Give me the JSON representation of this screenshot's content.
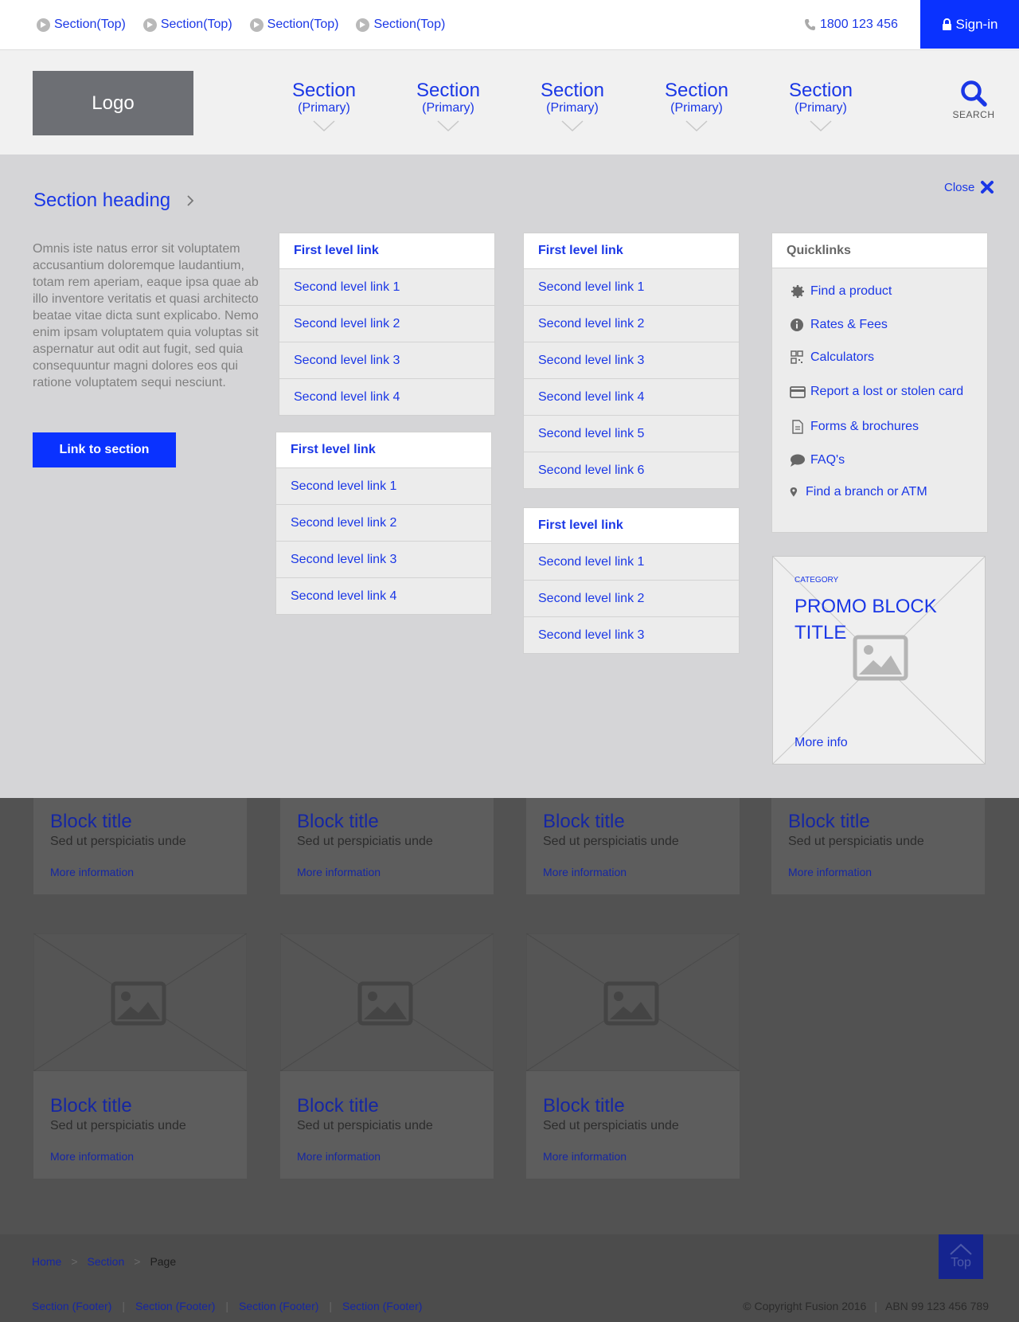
{
  "topbar": {
    "links": [
      "Section(Top)",
      "Section(Top)",
      "Section(Top)",
      "Section(Top)"
    ],
    "phone": "1800 123 456",
    "signin": "Sign-in"
  },
  "header": {
    "logo": "Logo",
    "primary_nav": [
      {
        "title": "Section",
        "sub": "(Primary)"
      },
      {
        "title": "Section",
        "sub": "(Primary)"
      },
      {
        "title": "Section",
        "sub": "(Primary)"
      },
      {
        "title": "Section",
        "sub": "(Primary)"
      },
      {
        "title": "Section",
        "sub": "(Primary)"
      }
    ],
    "search_label": "SEARCH"
  },
  "mega": {
    "heading": "Section heading",
    "close": "Close",
    "intro": "Omnis iste natus error sit voluptatem accusantium doloremque laudantium, totam rem aperiam, eaque ipsa quae ab illo inventore veritatis et quasi architecto beatae vitae dicta sunt explicabo. Nemo enim ipsam voluptatem quia voluptas sit aspernatur aut odit aut fugit, sed quia consequuntur magni dolores eos qui ratione voluptatem sequi nesciunt.",
    "button": "Link to section",
    "menus": [
      {
        "first": "First level link",
        "seconds": [
          "Second level link 1",
          "Second level link 2",
          "Second level link 3",
          "Second level link 4"
        ]
      },
      {
        "first": "First level link",
        "seconds": [
          "Second level link 1",
          "Second level link 2",
          "Second level link 3",
          "Second level link 4"
        ]
      },
      {
        "first": "First level link",
        "seconds": [
          "Second level link 1",
          "Second level link 2",
          "Second level link 3",
          "Second level link 4",
          "Second level link 5",
          "Second level link 6"
        ]
      },
      {
        "first": "First level link",
        "seconds": [
          "Second level link 1",
          "Second level link 2",
          "Second level link 3"
        ]
      }
    ],
    "quicklinks": {
      "title": "Quicklinks",
      "items": [
        {
          "icon": "gear-icon",
          "label": "Find a product"
        },
        {
          "icon": "info-icon",
          "label": "Rates & Fees"
        },
        {
          "icon": "calculator-icon",
          "label": "Calculators"
        },
        {
          "icon": "credit-card-icon",
          "label": "Report a lost or stolen card"
        },
        {
          "icon": "document-icon",
          "label": "Forms & brochures"
        },
        {
          "icon": "chat-bubble-icon",
          "label": "FAQ's"
        },
        {
          "icon": "map-pin-icon",
          "label": "Find a branch or ATM"
        }
      ]
    },
    "promo": {
      "category": "CATEGORY",
      "title": "PROMO BLOCK TITLE",
      "more": "More info"
    }
  },
  "cards": [
    {
      "title": "Block title",
      "sub": "Sed ut perspiciatis unde",
      "more": "More information"
    },
    {
      "title": "Block title",
      "sub": "Sed ut perspiciatis unde",
      "more": "More information"
    },
    {
      "title": "Block title",
      "sub": "Sed ut perspiciatis unde",
      "more": "More information"
    },
    {
      "title": "Block title",
      "sub": "Sed ut perspiciatis unde",
      "more": "More information"
    },
    {
      "title": "Block title",
      "sub": "Sed ut perspiciatis unde",
      "more": "More information"
    },
    {
      "title": "Block title",
      "sub": "Sed ut perspiciatis unde",
      "more": "More information"
    },
    {
      "title": "Block title",
      "sub": "Sed ut perspiciatis unde",
      "more": "More information"
    }
  ],
  "footer": {
    "breadcrumb": [
      "Home",
      "Section",
      "Page"
    ],
    "breadcrumb_sep": ">",
    "links": [
      "Section (Footer)",
      "Section (Footer)",
      "Section (Footer)",
      "Section (Footer)"
    ],
    "copyright": "© Copyright Fusion 2016",
    "abn": "ABN 99 123 456 789",
    "top": "Top"
  },
  "colors": {
    "accent": "#0a32ff",
    "link": "#1a37e6",
    "panel": "#d5d5d7",
    "overlay": "#525252"
  }
}
